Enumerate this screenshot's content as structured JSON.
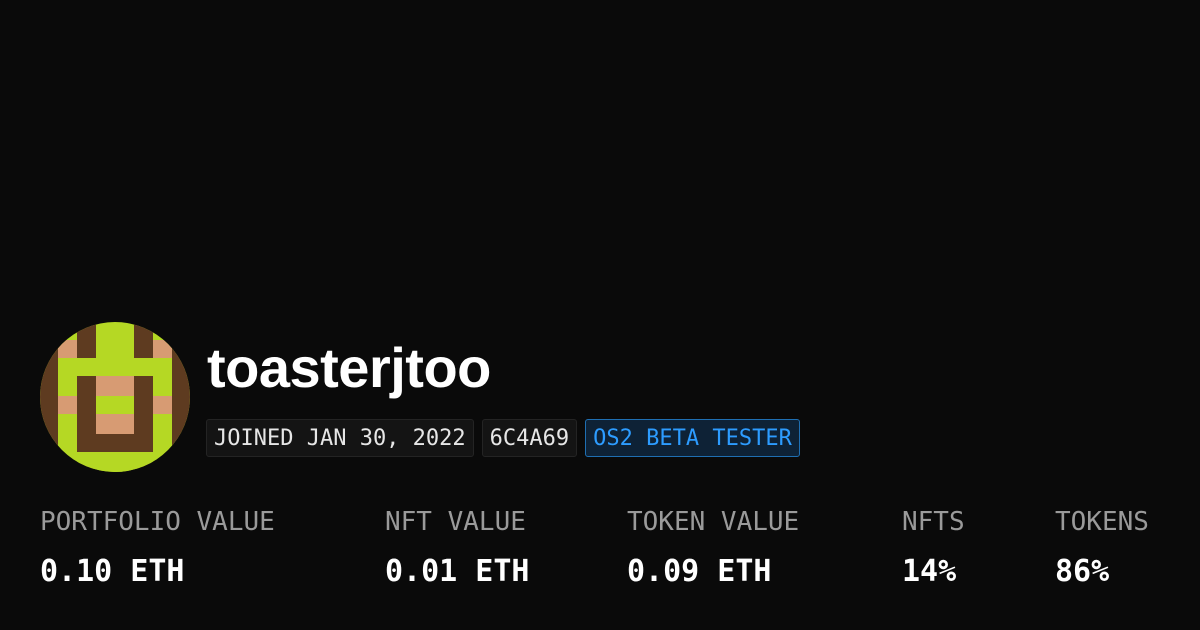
{
  "profile": {
    "username": "toasterjtoo",
    "avatar": {
      "icon": "pixel-art-avatar",
      "colors": {
        "green": "#b5d824",
        "brown": "#5e3b20",
        "skin": "#d79b73"
      }
    }
  },
  "badges": {
    "joined": "JOINED JAN 30, 2022",
    "address": "6C4A69",
    "beta": "OS2 BETA TESTER"
  },
  "stats": [
    {
      "label": "PORTFOLIO VALUE",
      "value": "0.10 ETH"
    },
    {
      "label": "NFT VALUE",
      "value": "0.01 ETH"
    },
    {
      "label": "TOKEN VALUE",
      "value": "0.09 ETH"
    },
    {
      "label": "NFTS",
      "value": "14%"
    },
    {
      "label": "TOKENS",
      "value": "86%"
    }
  ],
  "theme": {
    "background": "#0a0a0a",
    "accent": "#2d9cff"
  }
}
